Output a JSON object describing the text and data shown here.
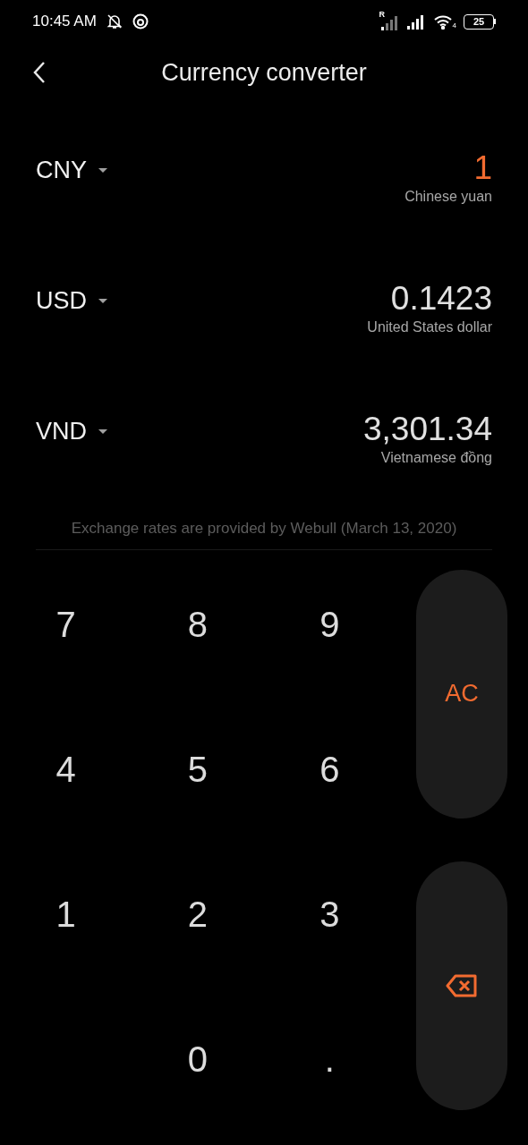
{
  "status_bar": {
    "time": "10:45 AM",
    "battery": "25",
    "wifi_badge": "4",
    "roaming": "R"
  },
  "header": {
    "title": "Currency converter"
  },
  "currencies": [
    {
      "code": "CNY",
      "value": "1",
      "name": "Chinese yuan",
      "selected": true
    },
    {
      "code": "USD",
      "value": "0.1423",
      "name": "United States dollar",
      "selected": false
    },
    {
      "code": "VND",
      "value": "3,301.34",
      "name": "Vietnamese đồng",
      "selected": false
    }
  ],
  "footnote": "Exchange rates are provided by Webull (March 13, 2020)",
  "keypad": {
    "keys": [
      {
        "label": "7"
      },
      {
        "label": "8"
      },
      {
        "label": "9"
      },
      {
        "label": "4"
      },
      {
        "label": "5"
      },
      {
        "label": "6"
      },
      {
        "label": "1"
      },
      {
        "label": "2"
      },
      {
        "label": "3"
      },
      {
        "label": "0"
      },
      {
        "label": "."
      }
    ],
    "side": [
      {
        "kind": "clear",
        "label": "AC"
      },
      {
        "kind": "backspace"
      }
    ]
  }
}
